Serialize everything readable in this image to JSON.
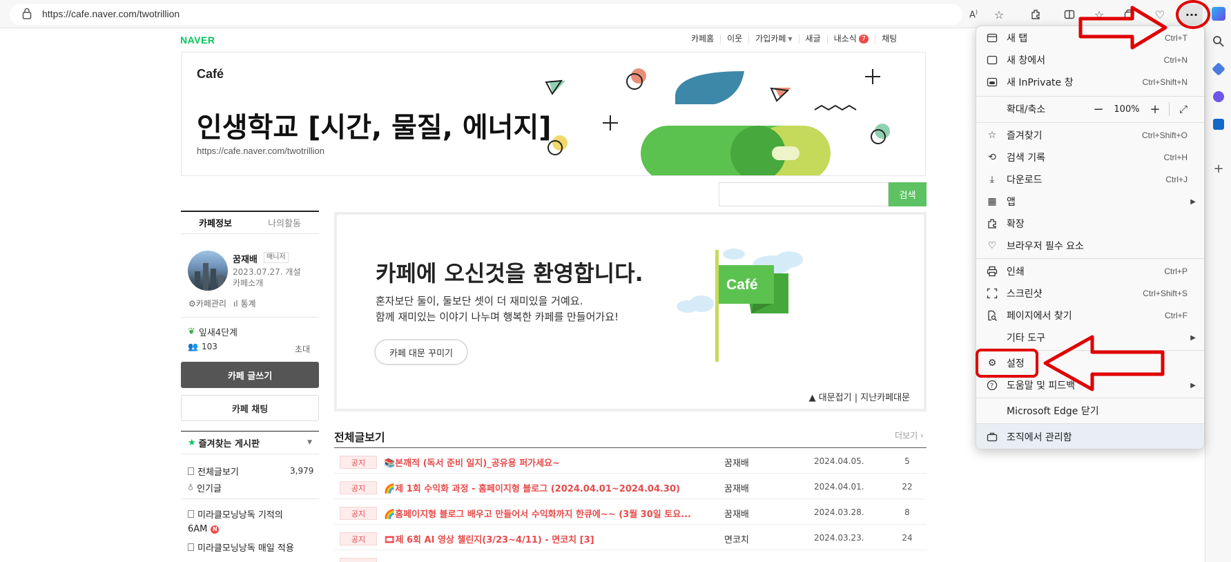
{
  "browser": {
    "url": "https://cafe.naver.com/twotrillion",
    "more_label": "···"
  },
  "cafe": {
    "naver_logo": "NAVER",
    "gnb": [
      {
        "label": "카페홈"
      },
      {
        "label": "이웃"
      },
      {
        "label": "가입카페"
      },
      {
        "label": "새글"
      },
      {
        "label": "내소식",
        "badge": "7"
      },
      {
        "label": "채팅"
      }
    ],
    "banner_logo": "Café",
    "title": "인생학교 [시간, 물질, 에너지]",
    "url": "https://cafe.naver.com/twotrillion",
    "search_button": "검색",
    "flag_logo": "Café"
  },
  "left": {
    "tab_info": "카페정보",
    "tab_activity": "나의활동",
    "manager_name": "꿈재배",
    "manager_tag": "매니저",
    "founded": "2023.07.27. 개설",
    "intro": "카페소개",
    "manage_link": "카페관리",
    "stats_link": "통계",
    "level": "잎새4단계",
    "members": "103",
    "invite": "초대",
    "write_button": "카페 글쓰기",
    "chat_button": "카페 채팅",
    "fav_board": "즐겨찾는 게시판",
    "menu": [
      {
        "label": "전체글보기",
        "count": "3,979"
      },
      {
        "label": "인기글"
      },
      {
        "label": "미라클모닝낭독 기적의"
      },
      {
        "label": "6AM"
      },
      {
        "label": "미라클모닝낭독 매일 적용"
      }
    ]
  },
  "welcome": {
    "title": "카페에 오신것을 환영합니다.",
    "line1": "혼자보단 둘이, 둘보단 셋이 더 재미있을 거예요.",
    "line2": "함께 재미있는 이야기 나누며 행복한 카페를 만들어가요!",
    "decorate_button": "카페 대문 꾸미기",
    "fold": "▲ 대문접기 | 지난카페대문"
  },
  "articles": {
    "title": "전체글보기",
    "more": "더보기 ›",
    "rows": [
      {
        "tag": "공지",
        "title": "📚본깨적 (독서 준비 일지)_공유용 퍼가세요~",
        "author": "꿈재배",
        "date": "2024.04.05.",
        "views": "5"
      },
      {
        "tag": "공지",
        "title": "🌈제 1회 수익화 과정 - 홈페이지형 블로그 (2024.04.01~2024.04.30)",
        "author": "꿈재배",
        "date": "2024.04.01.",
        "views": "22"
      },
      {
        "tag": "공지",
        "title": "🌈홈페이지형 블로그 배우고 만들어서 수익화까지 한큐에~~ (3월 30일 토요...",
        "author": "꿈재배",
        "date": "2024.03.28.",
        "views": "8"
      },
      {
        "tag": "공지",
        "title": "🎞제 6회 AI 영상 챌린지(3/23~4/11) - 면코치 [3]",
        "author": "면코치",
        "date": "2024.03.23.",
        "views": "24"
      }
    ]
  },
  "edge_menu": {
    "items": [
      {
        "label": "새 탭",
        "shortcut": "Ctrl+T"
      },
      {
        "label": "새 창에서",
        "shortcut": "Ctrl+N"
      },
      {
        "label": "새 InPrivate 창",
        "shortcut": "Ctrl+Shift+N"
      },
      {
        "label": "확대/축소",
        "zoom": "100%"
      },
      {
        "label": "즐겨찾기",
        "shortcut": "Ctrl+Shift+O"
      },
      {
        "label": "검색 기록",
        "shortcut": "Ctrl+H"
      },
      {
        "label": "다운로드",
        "shortcut": "Ctrl+J"
      },
      {
        "label": "앱"
      },
      {
        "label": "확장"
      },
      {
        "label": "브라우저 필수 요소"
      },
      {
        "label": "인쇄",
        "shortcut": "Ctrl+P"
      },
      {
        "label": "스크린샷",
        "shortcut": "Ctrl+Shift+S"
      },
      {
        "label": "페이지에서 찾기",
        "shortcut": "Ctrl+F"
      },
      {
        "label": "기타 도구"
      },
      {
        "label": "설정"
      },
      {
        "label": "도움말 및 피드백"
      },
      {
        "label": "Microsoft Edge 닫기"
      },
      {
        "label": "조직에서 관리함"
      }
    ]
  },
  "colors": {
    "naver_green": "#03c75a",
    "notice_red": "#e84b4b",
    "annotation_red": "#e00000"
  }
}
